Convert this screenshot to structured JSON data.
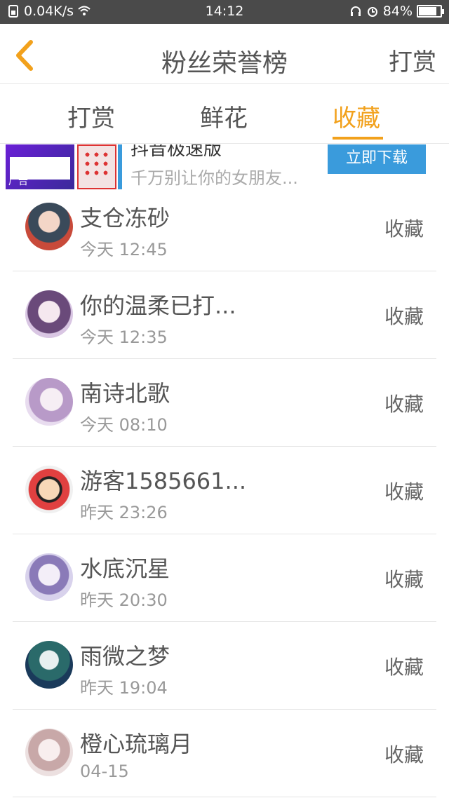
{
  "status_bar": {
    "speed": "0.04K/s",
    "time": "14:12",
    "battery": "84%",
    "battery_level": 0.84,
    "icons": [
      "sim-icon",
      "wifi-icon",
      "headset-icon",
      "alarm-icon",
      "battery-icon"
    ]
  },
  "header": {
    "title": "粉丝荣誉榜",
    "action": "打赏",
    "back_icon": "chevron-left-icon"
  },
  "tabs": [
    {
      "label": "打赏",
      "active": false
    },
    {
      "label": "鲜花",
      "active": false
    },
    {
      "label": "收藏",
      "active": true
    }
  ],
  "ad": {
    "title": "抖音极速版",
    "description": "千万别让你的女朋友...",
    "tag": "广告",
    "button": "立即下载"
  },
  "accent_color": "#f2a11c",
  "list": [
    {
      "name": "支仓冻砂",
      "time": "今天 12:45",
      "action": "收藏"
    },
    {
      "name": "你的温柔已打...",
      "time": "今天 12:35",
      "action": "收藏"
    },
    {
      "name": "南诗北歌",
      "time": "今天 08:10",
      "action": "收藏"
    },
    {
      "name": "游客1585661...",
      "time": "昨天 23:26",
      "action": "收藏"
    },
    {
      "name": "水底沉星",
      "time": "昨天 20:30",
      "action": "收藏"
    },
    {
      "name": "雨微之梦",
      "time": "昨天 19:04",
      "action": "收藏"
    },
    {
      "name": "橙心琉璃月",
      "time": "04-15",
      "action": "收藏"
    }
  ]
}
